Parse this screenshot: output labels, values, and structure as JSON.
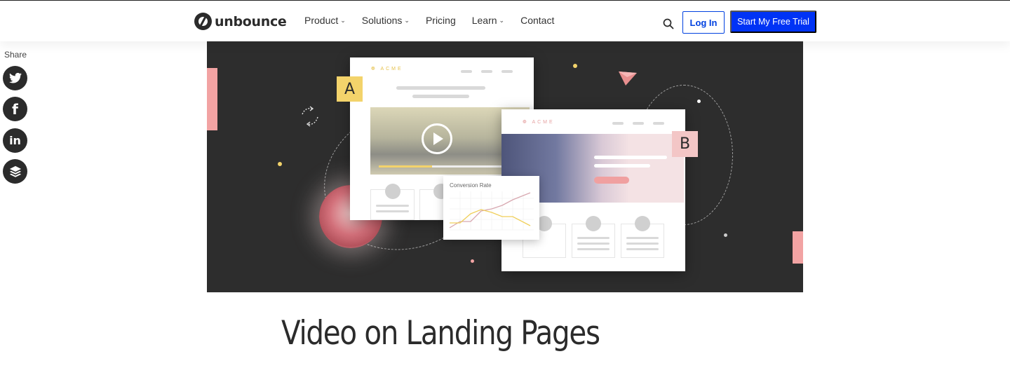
{
  "header": {
    "brand": "unbounce",
    "nav": [
      {
        "label": "Product",
        "has_dropdown": true
      },
      {
        "label": "Solutions",
        "has_dropdown": true
      },
      {
        "label": "Pricing",
        "has_dropdown": false
      },
      {
        "label": "Learn",
        "has_dropdown": true
      },
      {
        "label": "Contact",
        "has_dropdown": false
      }
    ],
    "search_icon": "search-icon",
    "login_label": "Log In",
    "trial_label": "Start My Free Trial",
    "accent": "#0033f5"
  },
  "share": {
    "label": "Share",
    "buttons": [
      {
        "name": "twitter",
        "icon": "twitter-icon"
      },
      {
        "name": "facebook",
        "icon": "facebook-icon"
      },
      {
        "name": "linkedin",
        "icon": "linkedin-icon"
      },
      {
        "name": "buffer",
        "icon": "buffer-icon"
      }
    ]
  },
  "hero": {
    "variant_a_label": "A",
    "variant_b_label": "B",
    "brand_mock": "ACME",
    "chart_title": "Conversion Rate",
    "colors": {
      "background": "#2d2d2d",
      "pink": "#f2a3a3",
      "yellow": "#f3d36b"
    }
  },
  "article": {
    "title_line1": "Video on Landing Pages"
  }
}
